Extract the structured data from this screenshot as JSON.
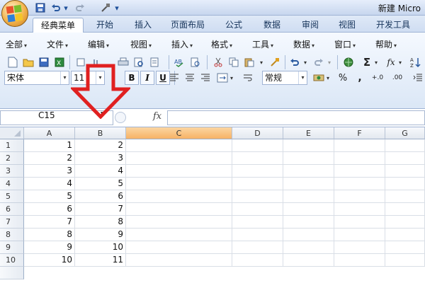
{
  "window": {
    "title": "新建 Micro"
  },
  "quick_access": {
    "icons": [
      "save-icon",
      "undo-icon",
      "redo-icon",
      "brush-icon",
      "dropdown-icon"
    ]
  },
  "tabs": [
    {
      "label": "经典菜单",
      "active": true
    },
    {
      "label": "开始"
    },
    {
      "label": "插入"
    },
    {
      "label": "页面布局"
    },
    {
      "label": "公式"
    },
    {
      "label": "数据"
    },
    {
      "label": "审阅"
    },
    {
      "label": "视图"
    },
    {
      "label": "开发工具"
    }
  ],
  "menu": {
    "items": [
      "全部",
      "文件",
      "编辑",
      "视图",
      "插入",
      "格式",
      "工具",
      "数据",
      "窗口",
      "帮助"
    ]
  },
  "toolbar": {
    "font_name": "宋体",
    "font_size": "11",
    "bold": "B",
    "italic": "I",
    "underline": "U",
    "number_format": "常规",
    "percent": "%",
    "comma": ",",
    "sigma": "Σ",
    "fx": "fx",
    "inc_decimal": "+.0",
    "dec_decimal": ".00"
  },
  "formula_bar": {
    "name_box": "C15",
    "fx": "fx",
    "value": ""
  },
  "columns": [
    "A",
    "B",
    "C",
    "D",
    "E",
    "F",
    "G"
  ],
  "selected_column": "C",
  "rows": [
    {
      "n": "1",
      "a": "1",
      "b": "2"
    },
    {
      "n": "2",
      "a": "2",
      "b": "3"
    },
    {
      "n": "3",
      "a": "3",
      "b": "4"
    },
    {
      "n": "4",
      "a": "4",
      "b": "5"
    },
    {
      "n": "5",
      "a": "5",
      "b": "6"
    },
    {
      "n": "6",
      "a": "6",
      "b": "7"
    },
    {
      "n": "7",
      "a": "7",
      "b": "8"
    },
    {
      "n": "8",
      "a": "8",
      "b": "9"
    },
    {
      "n": "9",
      "a": "9",
      "b": "10"
    },
    {
      "n": "10",
      "a": "10",
      "b": "11"
    }
  ],
  "colors": {
    "arrow": "#e02020",
    "selected_header": "#f7b265",
    "ribbon": "#dbe7f6"
  }
}
